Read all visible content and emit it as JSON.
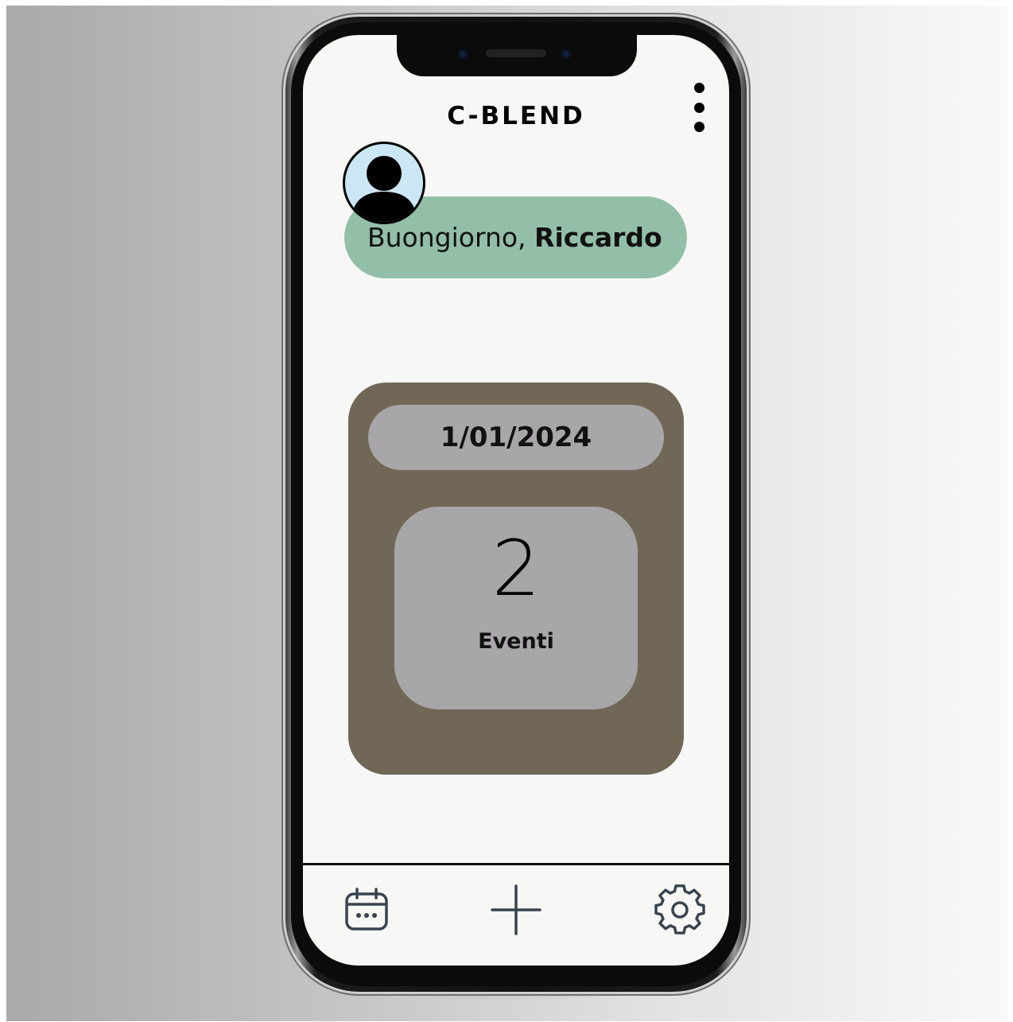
{
  "app": {
    "title": "C-BLEND"
  },
  "greeting": {
    "prefix": "Buongiorno, ",
    "name": "Riccardo"
  },
  "event_card": {
    "date": "1/01/2024",
    "count": "2",
    "count_label": "Eventi"
  },
  "nav": {
    "items": [
      {
        "icon": "calendar-icon"
      },
      {
        "icon": "plus-icon"
      },
      {
        "icon": "gear-icon"
      }
    ]
  },
  "colors": {
    "greeting_bg": "#93bfa8",
    "card_bg": "#716757",
    "pill_bg": "#a8a6a8",
    "screen_bg": "#f7f8f5",
    "avatar_bg": "#cbe7f5",
    "icon_stroke": "#3a4450"
  }
}
